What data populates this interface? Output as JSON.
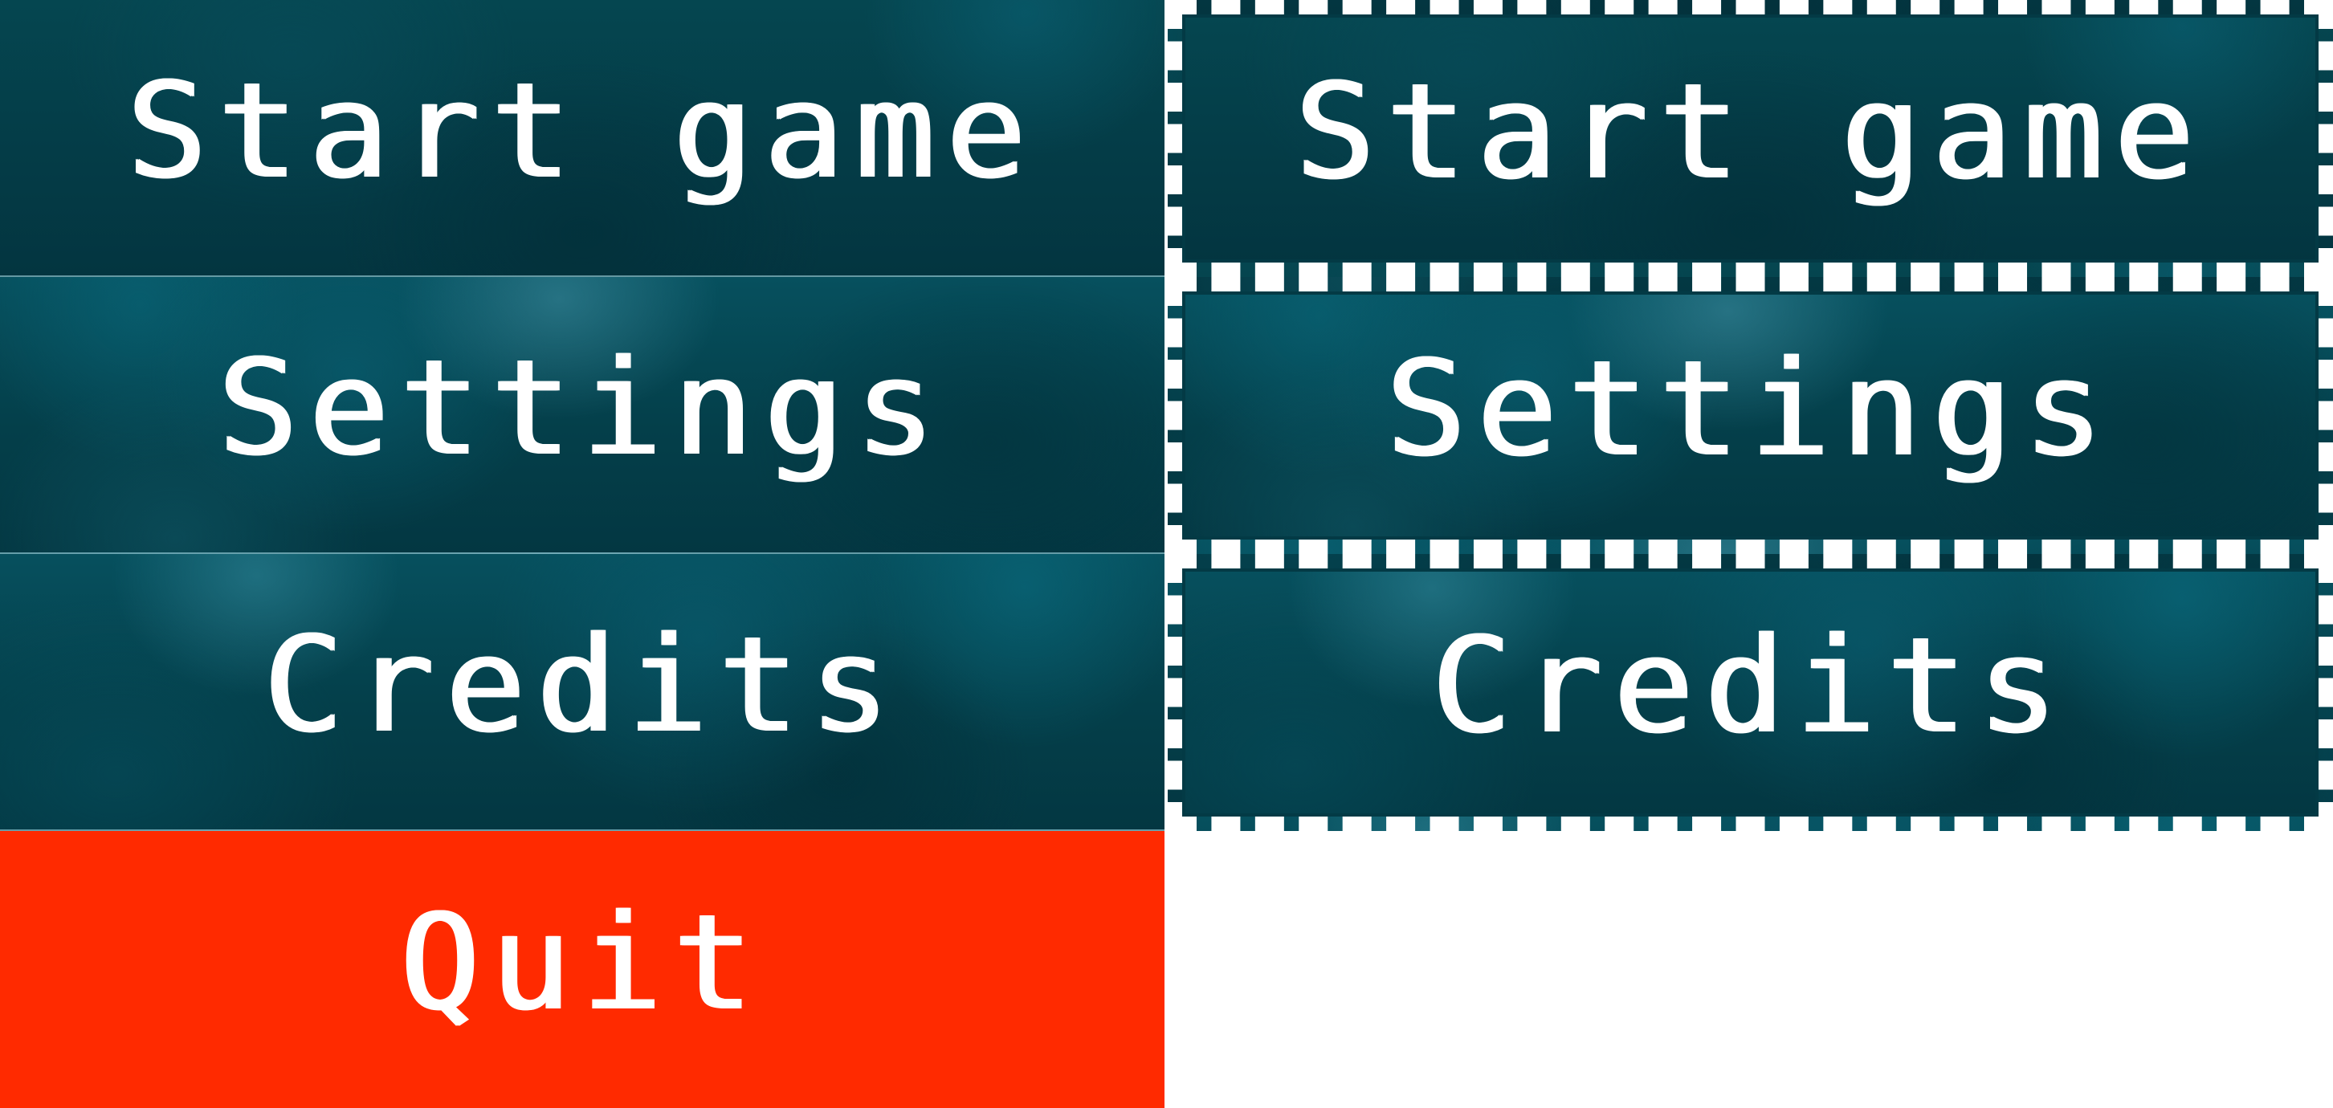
{
  "main_menu": {
    "buttons": [
      {
        "label": "Start game"
      },
      {
        "label": "Settings"
      },
      {
        "label": "Credits"
      },
      {
        "label": "Quit"
      }
    ]
  },
  "focused_menu": {
    "buttons": [
      {
        "label": "Start game"
      },
      {
        "label": "Settings"
      },
      {
        "label": "Credits"
      }
    ]
  },
  "colors": {
    "button_teal": "#043f4a",
    "button_danger": "#ff2a00",
    "label": "#ffffff",
    "focus_border": "#ffffff"
  }
}
